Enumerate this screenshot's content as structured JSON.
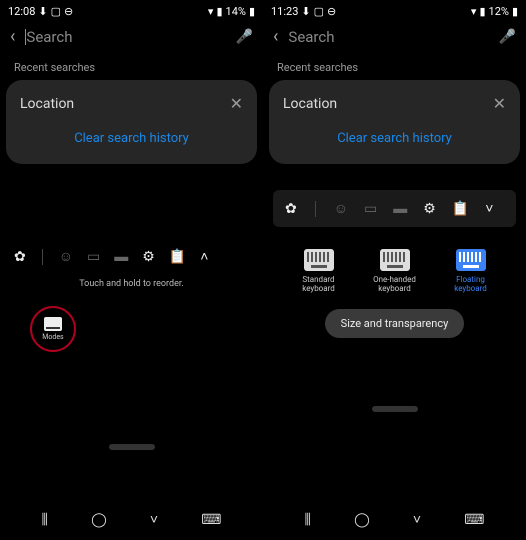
{
  "left": {
    "status": {
      "time": "12:08",
      "battery": "14%"
    },
    "search": {
      "placeholder": "Search"
    },
    "recent_label": "Recent searches",
    "location_label": "Location",
    "clear_label": "Clear search history",
    "hint": "Touch and hold to reorder.",
    "modes_label": "Modes"
  },
  "right": {
    "status": {
      "time": "11:23",
      "battery": "12%"
    },
    "search": {
      "placeholder": "Search"
    },
    "recent_label": "Recent searches",
    "location_label": "Location",
    "clear_label": "Clear search history",
    "modes": {
      "standard": "Standard keyboard",
      "onehanded": "One-handed keyboard",
      "floating": "Floating keyboard"
    },
    "size_btn": "Size and transparency"
  }
}
